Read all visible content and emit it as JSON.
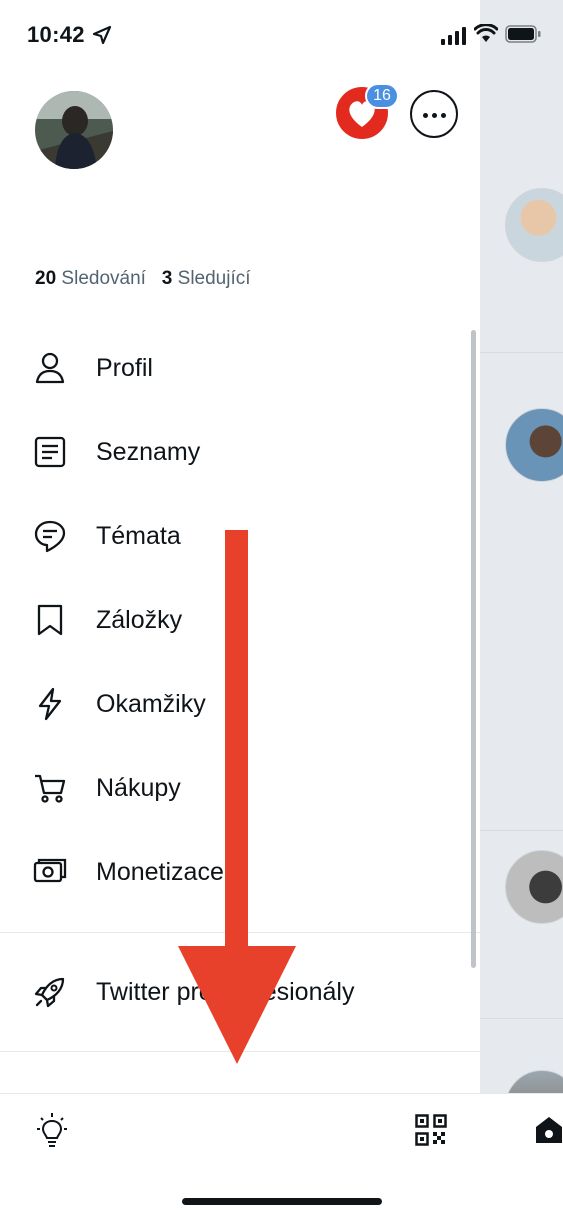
{
  "status_bar": {
    "time": "10:42"
  },
  "account": {
    "following_count": "20",
    "following_label": "Sledování",
    "followers_count": "3",
    "followers_label": "Sledující",
    "notification_badge": "16"
  },
  "menu": {
    "items": [
      {
        "label": "Profil",
        "icon": "person-icon"
      },
      {
        "label": "Seznamy",
        "icon": "list-icon"
      },
      {
        "label": "Témata",
        "icon": "topics-icon"
      },
      {
        "label": "Záložky",
        "icon": "bookmark-icon"
      },
      {
        "label": "Okamžiky",
        "icon": "lightning-icon"
      },
      {
        "label": "Nákupy",
        "icon": "cart-icon"
      },
      {
        "label": "Monetizace",
        "icon": "money-icon"
      }
    ],
    "professional": {
      "label": "Twitter pro profesionály",
      "icon": "rocket-icon"
    }
  },
  "colors": {
    "accent": "#1d9bf0",
    "badge": "#4a90e2",
    "arrow": "#e8412b",
    "text_secondary": "#536471"
  }
}
